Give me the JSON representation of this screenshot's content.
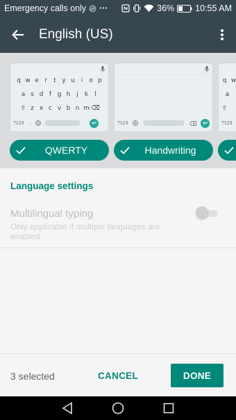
{
  "status_bar": {
    "carrier_text": "Emergency calls only",
    "more_glyph": "···",
    "battery_percent": "36%",
    "time": "10:55 AM",
    "icons": [
      "sync-icon",
      "more-dots-icon",
      "nfc-icon",
      "vibrate-icon",
      "wifi-icon",
      "battery-icon"
    ]
  },
  "app_bar": {
    "title": "English (US)",
    "back_icon": "arrow-back-icon",
    "menu_icon": "more-vert-icon"
  },
  "layouts": {
    "qwerty_rows": [
      [
        "q",
        "w",
        "e",
        "r",
        "t",
        "y",
        "u",
        "i",
        "o",
        "p"
      ],
      [
        "a",
        "s",
        "d",
        "f",
        "g",
        "h",
        "j",
        "k",
        "l"
      ],
      [
        "⇧",
        "z",
        "x",
        "c",
        "v",
        "b",
        "n",
        "m",
        "⌫"
      ]
    ],
    "num_key_label": "?123",
    "comma_label": ",",
    "period_label": ".",
    "items": [
      {
        "label": "QWERTY",
        "selected": true
      },
      {
        "label": "Handwriting",
        "selected": true
      },
      {
        "label": "",
        "selected": true
      }
    ],
    "third_preview_rows": [
      [
        "q",
        "w"
      ],
      [
        "a"
      ],
      [
        "⇧"
      ]
    ],
    "accent_color": "#00897b"
  },
  "settings": {
    "section_title": "Language settings",
    "multilingual": {
      "title": "Multilingual typing",
      "summary": "Only applicable if multiple languages are enabled",
      "enabled": false
    }
  },
  "footer": {
    "selected_count": "3 selected",
    "cancel_label": "CANCEL",
    "done_label": "DONE"
  },
  "nav_bar": {
    "icons": [
      "back-triangle-icon",
      "home-circle-icon",
      "recents-square-icon"
    ]
  }
}
